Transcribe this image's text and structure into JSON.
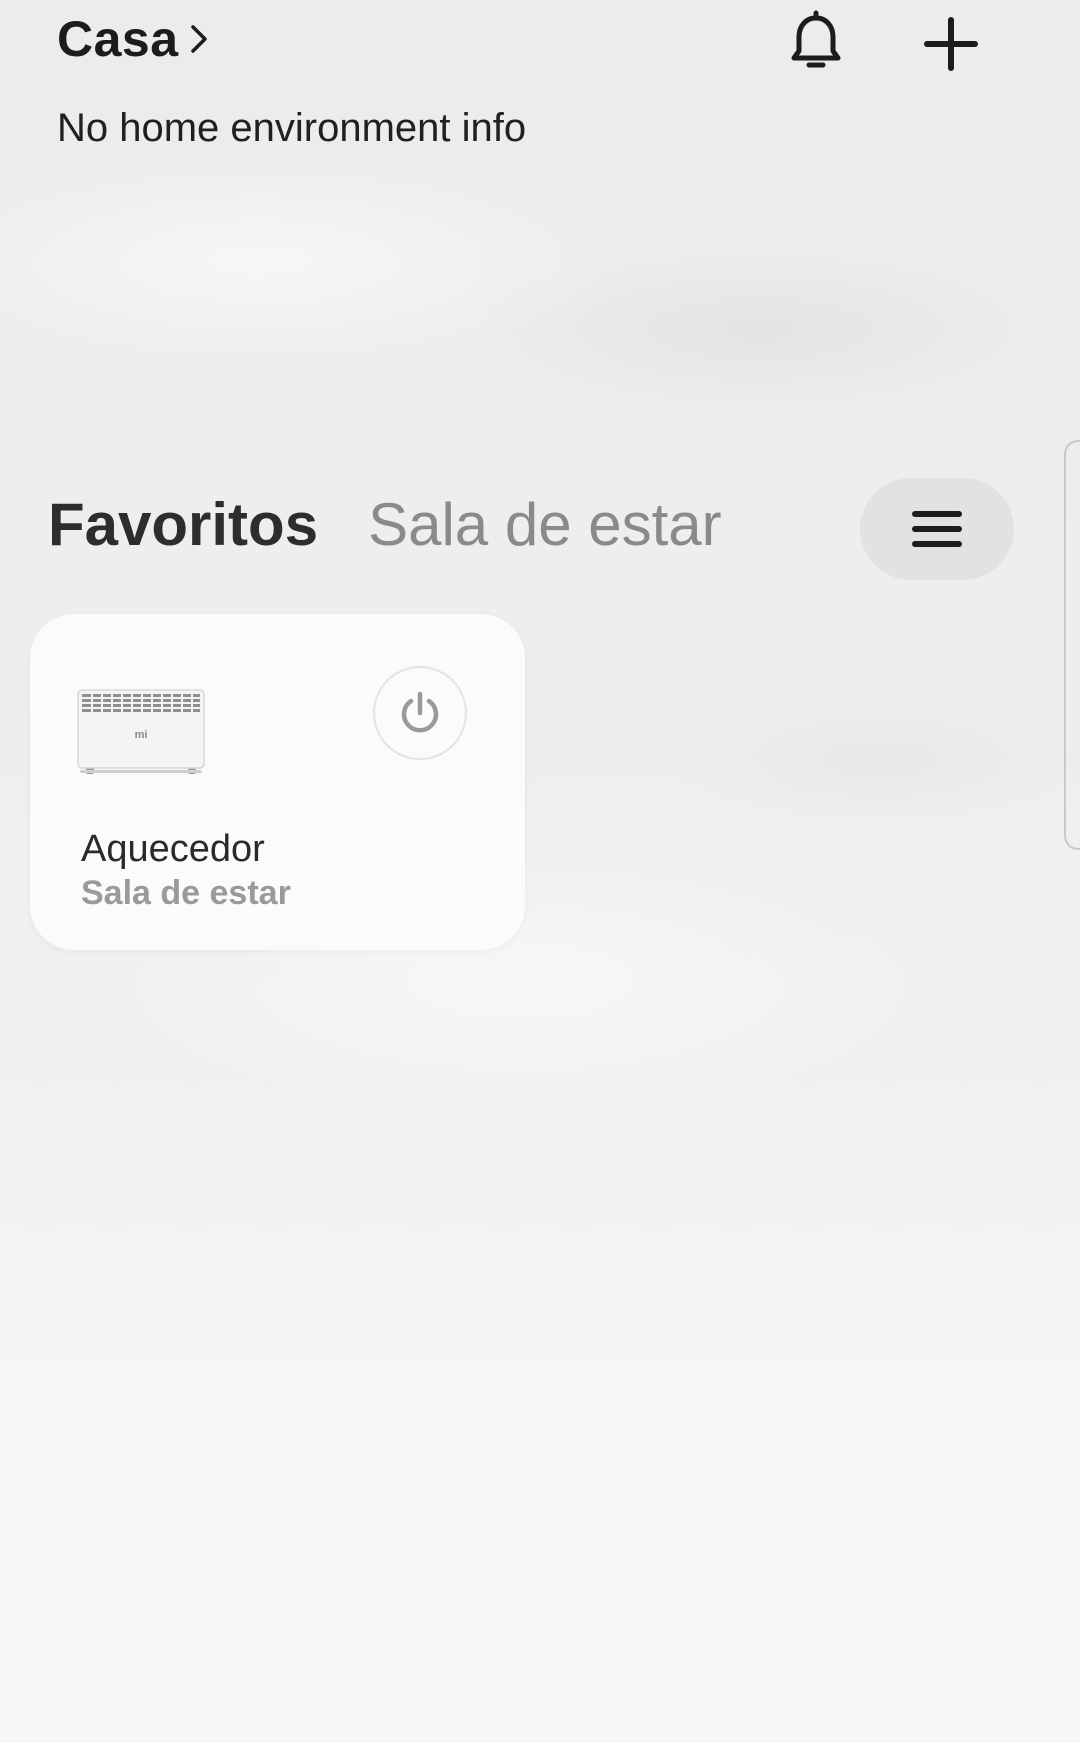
{
  "header": {
    "home_name": "Casa",
    "environment_info": "No home environment info"
  },
  "tabs": [
    {
      "label": "Favoritos",
      "active": true
    },
    {
      "label": "Sala de estar",
      "active": false
    }
  ],
  "devices": [
    {
      "name": "Aquecedor",
      "room": "Sala de estar",
      "brand_mark": "mi",
      "power": "off"
    }
  ],
  "icons": {
    "notifications": "bell-icon",
    "add": "plus-icon",
    "menu": "hamburger-icon",
    "power": "power-icon",
    "home_switch": "chevron-right-icon"
  },
  "colors": {
    "text_primary": "#1c1c1c",
    "text_secondary": "#8a8a8a",
    "card_background": "#fbfbfb",
    "menu_pill": "#e2e2e2"
  }
}
